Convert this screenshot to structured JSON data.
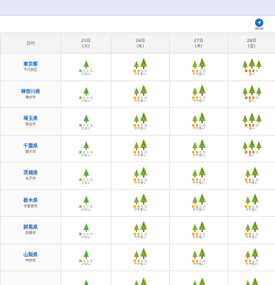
{
  "colors": {
    "lv1": "#8bc34a",
    "lv2": "#f2b705",
    "lv3": "#f07b1b",
    "empty": "#d6d6d6",
    "pref_link": "#2167c5",
    "location_button": "#1570d4"
  },
  "toolbar": {
    "location_icon": "location-arrow-icon",
    "location_label": "現在地"
  },
  "table": {
    "header_label": "日付",
    "dates": [
      {
        "day": "25日",
        "weekday": "(火)"
      },
      {
        "day": "26日",
        "weekday": "(水)"
      },
      {
        "day": "27日",
        "weekday": "(木)"
      },
      {
        "day": "28日",
        "weekday": "(金)"
      }
    ],
    "rows": [
      {
        "pref": "東京都",
        "city": "千代田区",
        "cells": [
          {
            "level": 1,
            "label": "少ない"
          },
          {
            "level": 2,
            "label": "やや多い"
          },
          {
            "level": 2,
            "label": "やや多い"
          },
          {
            "level": 3,
            "label": "多い"
          }
        ]
      },
      {
        "pref": "神奈川県",
        "city": "横浜市",
        "cells": [
          {
            "level": 1,
            "label": "少ない"
          },
          {
            "level": 2,
            "label": "やや多い"
          },
          {
            "level": 2,
            "label": "やや多い"
          },
          {
            "level": 3,
            "label": "多い"
          }
        ]
      },
      {
        "pref": "埼玉県",
        "city": "熊谷市",
        "cells": [
          {
            "level": 1,
            "label": "少ない"
          },
          {
            "level": 2,
            "label": "やや多い"
          },
          {
            "level": 2,
            "label": "やや多い"
          },
          {
            "level": 3,
            "label": "多い"
          }
        ]
      },
      {
        "pref": "千葉県",
        "city": "銚子市",
        "cells": [
          {
            "level": 1,
            "label": "少ない"
          },
          {
            "level": 2,
            "label": "やや多い"
          },
          {
            "level": 2,
            "label": "やや多い"
          },
          {
            "level": 3,
            "label": "多い"
          }
        ]
      },
      {
        "pref": "茨城県",
        "city": "水戸市",
        "cells": [
          {
            "level": 1,
            "label": "少ない"
          },
          {
            "level": 2,
            "label": "やや多い"
          },
          {
            "level": 2,
            "label": "やや多い"
          },
          {
            "level": 2,
            "label": "やや多い"
          }
        ]
      },
      {
        "pref": "栃木県",
        "city": "宇都宮市",
        "cells": [
          {
            "level": 1,
            "label": "少ない"
          },
          {
            "level": 2,
            "label": "やや多い"
          },
          {
            "level": 2,
            "label": "やや多い"
          },
          {
            "level": 2,
            "label": "やや多い"
          }
        ]
      },
      {
        "pref": "群馬県",
        "city": "前橋市",
        "cells": [
          {
            "level": 1,
            "label": "少ない"
          },
          {
            "level": 2,
            "label": "やや多い"
          },
          {
            "level": 2,
            "label": "やや多い"
          },
          {
            "level": 2,
            "label": "やや多い"
          }
        ]
      },
      {
        "pref": "山梨県",
        "city": "甲府市",
        "cells": [
          {
            "level": 1,
            "label": "少ない"
          },
          {
            "level": 2,
            "label": "やや多い"
          },
          {
            "level": 2,
            "label": "やや多い"
          },
          {
            "level": 2,
            "label": "やや多い"
          }
        ]
      },
      {
        "pref": "",
        "city": "",
        "cells": [
          {
            "level": 1,
            "label": ""
          },
          {
            "level": 2,
            "label": ""
          },
          {
            "level": 2,
            "label": ""
          },
          {
            "level": 2,
            "label": ""
          }
        ]
      }
    ]
  }
}
